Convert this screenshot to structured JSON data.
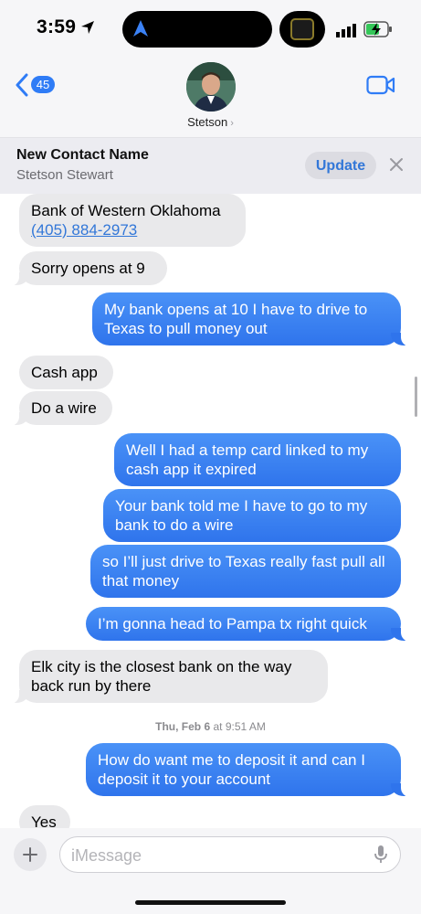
{
  "status_bar": {
    "time": "3:59"
  },
  "header": {
    "back_count": "45",
    "contact_name": "Stetson",
    "chevron": "›"
  },
  "banner": {
    "title": "New Contact Name",
    "subtitle": "Stetson Stewart",
    "update_label": "Update"
  },
  "messages": [
    {
      "side": "in",
      "lines": [
        "Bank of Western Oklahoma"
      ],
      "link": "(405) 884-2973"
    },
    {
      "side": "in",
      "text": "Sorry opens at 9"
    },
    {
      "side": "out",
      "text": "My bank opens at 10 I have to drive to Texas to pull money out"
    },
    {
      "side": "in",
      "text": "Cash app"
    },
    {
      "side": "in",
      "text": "Do a wire"
    },
    {
      "side": "out",
      "text": "Well I had a temp card linked to my cash app it expired"
    },
    {
      "side": "out",
      "text": "Your bank told me I have to go to my bank to do a wire"
    },
    {
      "side": "out",
      "text": "so I’ll just drive to Texas really fast pull all that money"
    },
    {
      "side": "out",
      "text": "I’m gonna head to Pampa tx right quick"
    },
    {
      "side": "in",
      "text": "Elk city is the closest bank on the way back run by there"
    },
    {
      "side": "out",
      "text": "How do want me to deposit it and can I deposit it to your account"
    },
    {
      "side": "in",
      "text": "Yes"
    }
  ],
  "timestamp": {
    "day": "Thu, Feb 6",
    "at": "at",
    "time": "9:51 AM"
  },
  "input": {
    "placeholder": "iMessage"
  },
  "colors": {
    "accent": "#2f7cf6",
    "outgoing_bubble": "#3a85f3",
    "incoming_bubble": "#e9e9eb"
  },
  "icons": [
    "location-arrow-icon",
    "navigation-icon",
    "signal-icon",
    "battery-charging-icon",
    "back-chevron-icon",
    "video-camera-icon",
    "close-icon",
    "plus-icon",
    "microphone-icon"
  ]
}
